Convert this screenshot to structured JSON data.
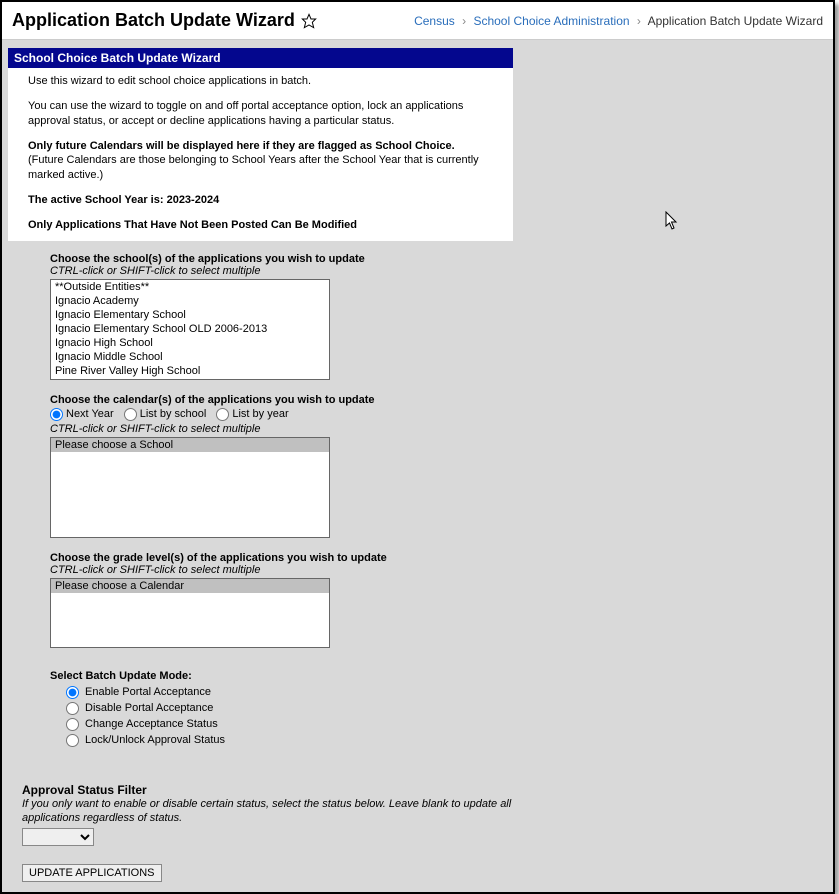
{
  "header": {
    "title": "Application Batch Update Wizard",
    "breadcrumb": {
      "item1": "Census",
      "item2": "School Choice Administration",
      "item3": "Application Batch Update Wizard"
    }
  },
  "section_title": "School Choice Batch Update Wizard",
  "intro": {
    "p1": "Use this wizard to edit school choice applications in batch.",
    "p2": "You can use the wizard to toggle on and off portal acceptance option, lock an applications approval status, or accept or decline applications having a particular status.",
    "p3_bold": "Only future Calendars will be displayed here if they are flagged as School Choice.",
    "p3_rest": " (Future Calendars are those belonging to School Years after the School Year that is currently marked active.)",
    "p4": "The active School Year is: 2023-2024",
    "p5": "Only Applications That Have Not Been Posted Can Be Modified"
  },
  "schools": {
    "label": "Choose the school(s) of the applications you wish to update",
    "hint": "CTRL-click or SHIFT-click to select multiple",
    "options": [
      "**Outside Entities**",
      "Ignacio Academy",
      "Ignacio Elementary School",
      "Ignacio Elementary School OLD 2006-2013",
      "Ignacio High School",
      "Ignacio Middle School",
      "Pine River Valley High School"
    ]
  },
  "calendars": {
    "label": "Choose the calendar(s) of the applications you wish to update",
    "hint": "CTRL-click or SHIFT-click to select multiple",
    "radios": {
      "r1": "Next Year",
      "r2": "List by school",
      "r3": "List by year"
    },
    "placeholder": "Please choose a School"
  },
  "grades": {
    "label": "Choose the grade level(s) of the applications you wish to update",
    "hint": "CTRL-click or SHIFT-click to select multiple",
    "placeholder": "Please choose a Calendar"
  },
  "mode": {
    "label": "Select Batch Update Mode:",
    "radios": {
      "r1": "Enable Portal Acceptance",
      "r2": "Disable Portal Acceptance",
      "r3": "Change Acceptance Status",
      "r4": "Lock/Unlock Approval Status"
    }
  },
  "filter": {
    "heading": "Approval Status Filter",
    "hint": "If you only want to enable or disable certain status, select the status below. Leave blank to update all applications regardless of status."
  },
  "button": "UPDATE APPLICATIONS"
}
